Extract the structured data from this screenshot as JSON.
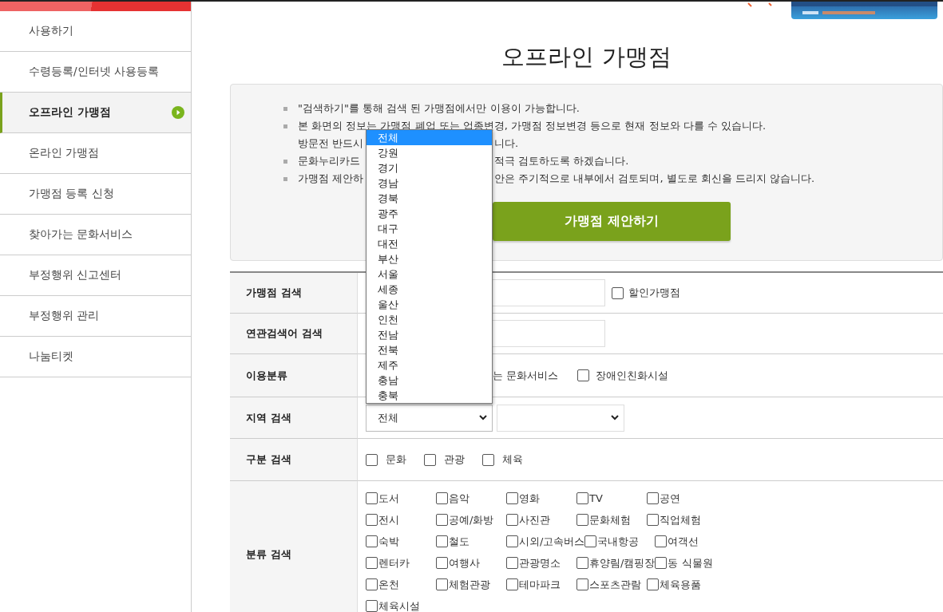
{
  "sidebar": {
    "items": [
      {
        "label": "사용하기",
        "selected": false
      },
      {
        "label": "수령등록/인터넷 사용등록",
        "selected": false
      },
      {
        "label": "오프라인 가맹점",
        "selected": true
      },
      {
        "label": "온라인 가맹점",
        "selected": false
      },
      {
        "label": "가맹점 등록 신청",
        "selected": false
      },
      {
        "label": "찾아가는 문화서비스",
        "selected": false
      },
      {
        "label": "부정행위 신고센터",
        "selected": false
      },
      {
        "label": "부정행위 관리",
        "selected": false
      },
      {
        "label": "나눔티켓",
        "selected": false
      }
    ]
  },
  "page_title": "오프라인 가맹점",
  "notice": {
    "items": [
      {
        "lines": [
          {
            "segments": [
              "\"검색하기\"를 통해 검색 된 가맹점에서만 이용이 가능합니다."
            ]
          }
        ]
      },
      {
        "lines": [
          {
            "segments": [
              "본 화면의 정보는 가맹점 폐업 또는 업종변경, 가맹점 정보변경 등으로 현재 정보와 다를 수 있습니다."
            ]
          },
          {
            "segments": [
              "방문전 반드시",
              "니다."
            ]
          }
        ]
      },
      {
        "lines": [
          {
            "segments": [
              "문화누리카드",
              "적극 검토하도록 하겠습니다."
            ]
          }
        ]
      },
      {
        "lines": [
          {
            "segments": [
              "가맹점 제안하",
              "안은 주기적으로 내부에서 검토되며, 별도로 회신을 드리지 않습니다."
            ]
          }
        ]
      }
    ],
    "button": "가맹점 제안하기"
  },
  "search_form": {
    "rows": [
      {
        "label": "가맹점 검색",
        "kind": "keyword",
        "checkbox": {
          "label": "할인가맹점",
          "checked": false
        }
      },
      {
        "label": "연관검색어 검색",
        "kind": "keyword"
      },
      {
        "label": "이용분류",
        "kind": "usage",
        "fragment": "는 문화서비스",
        "options": [
          {
            "label": "장애인친화시설",
            "checked": false
          }
        ]
      },
      {
        "label": "지역 검색",
        "kind": "selects",
        "selects": [
          {
            "value": "전체",
            "expanded": true,
            "options": [
              {
                "label": "전체",
                "selected": true
              },
              {
                "label": "강원",
                "selected": false
              },
              {
                "label": "경기",
                "selected": false
              },
              {
                "label": "경남",
                "selected": false
              },
              {
                "label": "경북",
                "selected": false
              },
              {
                "label": "광주",
                "selected": false
              },
              {
                "label": "대구",
                "selected": false
              },
              {
                "label": "대전",
                "selected": false
              },
              {
                "label": "부산",
                "selected": false
              },
              {
                "label": "서울",
                "selected": false
              },
              {
                "label": "세종",
                "selected": false
              },
              {
                "label": "울산",
                "selected": false
              },
              {
                "label": "인천",
                "selected": false
              },
              {
                "label": "전남",
                "selected": false
              },
              {
                "label": "전북",
                "selected": false
              },
              {
                "label": "제주",
                "selected": false
              },
              {
                "label": "충남",
                "selected": false
              },
              {
                "label": "충북",
                "selected": false
              }
            ]
          },
          {
            "expanded": false
          }
        ]
      },
      {
        "label": "구분 검색",
        "kind": "checks",
        "options": [
          {
            "label": "문화",
            "checked": false
          },
          {
            "label": "관광",
            "checked": false
          },
          {
            "label": "체육",
            "checked": false
          }
        ]
      },
      {
        "label": "분류 검색",
        "kind": "grid",
        "options": [
          {
            "label": "도서",
            "checked": false
          },
          {
            "label": "음악",
            "checked": false
          },
          {
            "label": "영화",
            "checked": false
          },
          {
            "label": "TV",
            "checked": false
          },
          {
            "label": "공연",
            "checked": false
          },
          {
            "label": "전시",
            "checked": false
          },
          {
            "label": "공예/화방",
            "checked": false
          },
          {
            "label": "사진관",
            "checked": false
          },
          {
            "label": "문화체험",
            "checked": false
          },
          {
            "label": "직업체험",
            "checked": false
          },
          {
            "label": "숙박",
            "checked": false
          },
          {
            "label": "철도",
            "checked": false
          },
          {
            "label": "시외/고속버스",
            "checked": false
          },
          {
            "label": "국내항공",
            "checked": false
          },
          {
            "label": "여객선",
            "checked": false
          },
          {
            "label": "렌터카",
            "checked": false
          },
          {
            "label": "여행사",
            "checked": false
          },
          {
            "label": "관광명소",
            "checked": false
          },
          {
            "label": "휴양림/캠핑장",
            "checked": false
          },
          {
            "label": "동 식물원",
            "checked": false
          },
          {
            "label": "온천",
            "checked": false
          },
          {
            "label": "체험관광",
            "checked": false
          },
          {
            "label": "테마파크",
            "checked": false
          },
          {
            "label": "스포츠관람",
            "checked": false
          },
          {
            "label": "체육용품",
            "checked": false
          },
          {
            "label": "체육시설",
            "checked": false
          }
        ]
      }
    ]
  }
}
